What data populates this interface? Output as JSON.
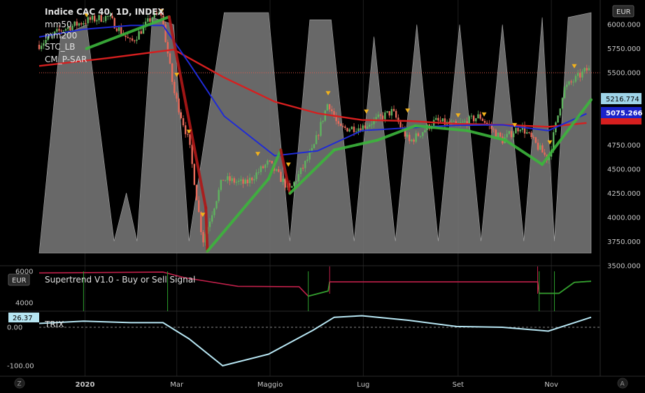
{
  "title": "Indice CAC 40, 1D, INDEX",
  "currency": "EUR",
  "indicators": [
    "mm50",
    "mm200",
    "STC_LB",
    "CM_P-SAR"
  ],
  "sub_panels": {
    "supertrend": {
      "label": "Supertrend V1.0 - Buy or Sell Signal",
      "currency": "EUR"
    },
    "trix": {
      "label": "TRIX",
      "value": "26.37"
    }
  },
  "price_tags": [
    {
      "label": "5216.774",
      "bg": "#9fd4e8",
      "fg": "#000000"
    },
    {
      "label": "5075.266",
      "bg": "#1a23c9",
      "fg": "#ffffff"
    }
  ],
  "buttons": {
    "left": "Z",
    "right": "A"
  },
  "colors": {
    "mm50": "#1f2bd6",
    "mm200": "#d61f1f",
    "stc_fill": "#7a7a7a",
    "sar_up": "#3cb53c",
    "sar_down": "#b01818",
    "candle_up": "#5fb35f",
    "candle_down": "#e86a5a",
    "trix": "#b7e6f3",
    "supertrend_bull": "#2da02d",
    "supertrend_bear": "#c0204a",
    "signal": "#f2b21b"
  },
  "chart_data": {
    "type": "line",
    "x_labels": [
      "2020",
      "Mar",
      "Maggio",
      "Lug",
      "Set",
      "Nov"
    ],
    "price_axis": {
      "ticks": [
        "6000.000",
        "5750.000",
        "5500.000",
        "5000.000",
        "4750.000",
        "4500.000",
        "4250.000",
        "4000.000",
        "3750.000",
        "3500.000"
      ],
      "range": [
        3500,
        6250
      ]
    },
    "supertrend_axis": {
      "ticks": [
        "6000",
        "4000"
      ]
    },
    "trix_axis": {
      "ticks": [
        "0.00",
        "-100.00"
      ]
    },
    "price_series": [
      {
        "d": "2019-12-02",
        "v": 5790
      },
      {
        "d": "2019-12-16",
        "v": 5940
      },
      {
        "d": "2020-01-02",
        "v": 6040
      },
      {
        "d": "2020-01-16",
        "v": 6080
      },
      {
        "d": "2020-01-31",
        "v": 5810
      },
      {
        "d": "2020-02-14",
        "v": 6080
      },
      {
        "d": "2020-02-20",
        "v": 6110
      },
      {
        "d": "2020-02-28",
        "v": 5310
      },
      {
        "d": "2020-03-09",
        "v": 4780
      },
      {
        "d": "2020-03-18",
        "v": 3750
      },
      {
        "d": "2020-03-31",
        "v": 4400
      },
      {
        "d": "2020-04-15",
        "v": 4350
      },
      {
        "d": "2020-04-30",
        "v": 4570
      },
      {
        "d": "2020-05-14",
        "v": 4280
      },
      {
        "d": "2020-05-29",
        "v": 4700
      },
      {
        "d": "2020-06-08",
        "v": 5200
      },
      {
        "d": "2020-06-15",
        "v": 4920
      },
      {
        "d": "2020-06-30",
        "v": 4935
      },
      {
        "d": "2020-07-20",
        "v": 5100
      },
      {
        "d": "2020-07-31",
        "v": 4780
      },
      {
        "d": "2020-08-17",
        "v": 5000
      },
      {
        "d": "2020-08-31",
        "v": 4950
      },
      {
        "d": "2020-09-15",
        "v": 5050
      },
      {
        "d": "2020-09-30",
        "v": 4800
      },
      {
        "d": "2020-10-12",
        "v": 4950
      },
      {
        "d": "2020-10-30",
        "v": 4600
      },
      {
        "d": "2020-11-09",
        "v": 5330
      },
      {
        "d": "2020-11-24",
        "v": 5530
      }
    ],
    "mm50": [
      {
        "d": "2019-12-02",
        "v": 5870
      },
      {
        "d": "2019-12-31",
        "v": 5950
      },
      {
        "d": "2020-01-31",
        "v": 5990
      },
      {
        "d": "2020-02-21",
        "v": 5990
      },
      {
        "d": "2020-03-09",
        "v": 5600
      },
      {
        "d": "2020-04-01",
        "v": 5050
      },
      {
        "d": "2020-05-04",
        "v": 4640
      },
      {
        "d": "2020-06-01",
        "v": 4690
      },
      {
        "d": "2020-06-30",
        "v": 4900
      },
      {
        "d": "2020-07-31",
        "v": 4930
      },
      {
        "d": "2020-08-31",
        "v": 4955
      },
      {
        "d": "2020-09-30",
        "v": 4960
      },
      {
        "d": "2020-10-30",
        "v": 4900
      },
      {
        "d": "2020-11-24",
        "v": 5075
      }
    ],
    "mm200": [
      {
        "d": "2019-12-02",
        "v": 5570
      },
      {
        "d": "2020-01-15",
        "v": 5650
      },
      {
        "d": "2020-02-28",
        "v": 5740
      },
      {
        "d": "2020-04-01",
        "v": 5450
      },
      {
        "d": "2020-05-04",
        "v": 5200
      },
      {
        "d": "2020-06-01",
        "v": 5080
      },
      {
        "d": "2020-06-30",
        "v": 5010
      },
      {
        "d": "2020-07-31",
        "v": 5000
      },
      {
        "d": "2020-08-31",
        "v": 4970
      },
      {
        "d": "2020-09-30",
        "v": 4960
      },
      {
        "d": "2020-10-30",
        "v": 4940
      },
      {
        "d": "2020-11-24",
        "v": 4980
      }
    ],
    "stc_lb_pct": [
      {
        "d": "2019-12-02",
        "v": 0
      },
      {
        "d": "2019-12-16",
        "v": 90
      },
      {
        "d": "2020-01-02",
        "v": 95
      },
      {
        "d": "2020-01-20",
        "v": 5
      },
      {
        "d": "2020-01-28",
        "v": 25
      },
      {
        "d": "2020-02-04",
        "v": 5
      },
      {
        "d": "2020-02-14",
        "v": 98
      },
      {
        "d": "2020-02-28",
        "v": 95
      },
      {
        "d": "2020-03-09",
        "v": 5
      },
      {
        "d": "2020-04-01",
        "v": 100
      },
      {
        "d": "2020-04-30",
        "v": 100
      },
      {
        "d": "2020-05-14",
        "v": 5
      },
      {
        "d": "2020-05-27",
        "v": 97
      },
      {
        "d": "2020-06-10",
        "v": 97
      },
      {
        "d": "2020-06-25",
        "v": 5
      },
      {
        "d": "2020-07-08",
        "v": 90
      },
      {
        "d": "2020-07-22",
        "v": 5
      },
      {
        "d": "2020-08-05",
        "v": 95
      },
      {
        "d": "2020-08-19",
        "v": 5
      },
      {
        "d": "2020-09-02",
        "v": 95
      },
      {
        "d": "2020-09-16",
        "v": 5
      },
      {
        "d": "2020-09-30",
        "v": 95
      },
      {
        "d": "2020-10-14",
        "v": 5
      },
      {
        "d": "2020-10-26",
        "v": 98
      },
      {
        "d": "2020-11-03",
        "v": 5
      },
      {
        "d": "2020-11-12",
        "v": 98
      },
      {
        "d": "2020-11-27",
        "v": 100
      }
    ],
    "sar_dots": [
      {
        "d": "2020-01-02",
        "v": 5750,
        "dir": "up"
      },
      {
        "d": "2020-02-25",
        "v": 6080,
        "dir": "down"
      },
      {
        "d": "2020-03-20",
        "v": 4100,
        "dir": "down"
      },
      {
        "d": "2020-03-21",
        "v": 3650,
        "dir": "up"
      },
      {
        "d": "2020-04-30",
        "v": 4400,
        "dir": "up"
      },
      {
        "d": "2020-05-08",
        "v": 4700,
        "dir": "down"
      },
      {
        "d": "2020-05-14",
        "v": 4250,
        "dir": "up"
      },
      {
        "d": "2020-06-12",
        "v": 4700,
        "dir": "up"
      },
      {
        "d": "2020-07-10",
        "v": 4800,
        "dir": "up"
      },
      {
        "d": "2020-08-04",
        "v": 4950,
        "dir": "up"
      },
      {
        "d": "2020-09-07",
        "v": 4900,
        "dir": "up"
      },
      {
        "d": "2020-10-02",
        "v": 4800,
        "dir": "up"
      },
      {
        "d": "2020-10-26",
        "v": 4550,
        "dir": "up"
      },
      {
        "d": "2020-11-27",
        "v": 5220,
        "dir": "up"
      }
    ],
    "signals": [
      {
        "d": "2020-01-02",
        "v": 6090
      },
      {
        "d": "2020-02-20",
        "v": 6130
      },
      {
        "d": "2020-03-01",
        "v": 5470
      },
      {
        "d": "2020-03-09",
        "v": 4880
      },
      {
        "d": "2020-03-18",
        "v": 4020
      },
      {
        "d": "2020-04-23",
        "v": 4650
      },
      {
        "d": "2020-05-13",
        "v": 4540
      },
      {
        "d": "2020-06-08",
        "v": 5280
      },
      {
        "d": "2020-07-03",
        "v": 5090
      },
      {
        "d": "2020-07-30",
        "v": 5100
      },
      {
        "d": "2020-09-01",
        "v": 5050
      },
      {
        "d": "2020-09-18",
        "v": 5060
      },
      {
        "d": "2020-10-08",
        "v": 4950
      },
      {
        "d": "2020-10-31",
        "v": 4770
      },
      {
        "d": "2020-11-16",
        "v": 5560
      }
    ],
    "supertrend_series": [
      {
        "d": "2019-12-02",
        "v": 5900,
        "dir": "bear"
      },
      {
        "d": "2020-02-21",
        "v": 5950,
        "dir": "bear"
      },
      {
        "d": "2020-03-06",
        "v": 5600,
        "dir": "bear"
      },
      {
        "d": "2020-04-10",
        "v": 5050,
        "dir": "bear"
      },
      {
        "d": "2020-05-20",
        "v": 5020,
        "dir": "bear"
      },
      {
        "d": "2020-05-26",
        "v": 4420,
        "dir": "bull"
      },
      {
        "d": "2020-06-08",
        "v": 4750,
        "dir": "bull"
      },
      {
        "d": "2020-06-09",
        "v": 5330,
        "dir": "bear"
      },
      {
        "d": "2020-10-23",
        "v": 5330,
        "dir": "bear"
      },
      {
        "d": "2020-10-24",
        "v": 4600,
        "dir": "bull"
      },
      {
        "d": "2020-11-06",
        "v": 4600,
        "dir": "bull"
      },
      {
        "d": "2020-11-16",
        "v": 5300,
        "dir": "bull"
      },
      {
        "d": "2020-11-27",
        "v": 5370,
        "dir": "bull"
      }
    ],
    "trix_series": [
      {
        "d": "2019-12-02",
        "v": 10
      },
      {
        "d": "2019-12-31",
        "v": 16
      },
      {
        "d": "2020-01-31",
        "v": 12
      },
      {
        "d": "2020-02-21",
        "v": 12
      },
      {
        "d": "2020-03-09",
        "v": -30
      },
      {
        "d": "2020-03-31",
        "v": -100
      },
      {
        "d": "2020-04-30",
        "v": -70
      },
      {
        "d": "2020-05-29",
        "v": -8
      },
      {
        "d": "2020-06-12",
        "v": 26
      },
      {
        "d": "2020-06-30",
        "v": 30
      },
      {
        "d": "2020-07-31",
        "v": 18
      },
      {
        "d": "2020-08-31",
        "v": 2
      },
      {
        "d": "2020-09-30",
        "v": 0
      },
      {
        "d": "2020-10-30",
        "v": -10
      },
      {
        "d": "2020-11-27",
        "v": 26
      }
    ]
  }
}
